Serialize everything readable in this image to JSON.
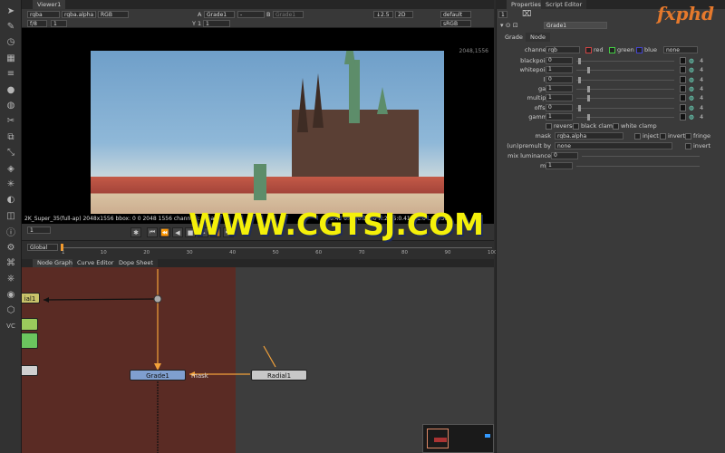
{
  "left_toolbar": {
    "icons": [
      "pointer-icon",
      "paint-icon",
      "clock-icon",
      "filter-icon",
      "channels-icon",
      "color-icon",
      "blur-icon",
      "keyer-icon",
      "merge-icon",
      "transform-icon",
      "3d-icon",
      "particles-icon",
      "deep-icon",
      "views-icon",
      "metadata-icon",
      "toolsets-icon",
      "other-icon",
      "furnace-icon",
      "ocula-icon",
      "cara-icon",
      "vc-icon"
    ],
    "vc_label": "VC"
  },
  "viewer": {
    "tab_label": "Viewer1",
    "channels": "rgba",
    "alpha": "rgba.alpha",
    "display": "RGB",
    "input_a_label": "A",
    "input_a": "Grade1",
    "input_a_op": "-",
    "input_b_label": "B",
    "input_b": "Grade1",
    "zoom": "f/8",
    "frame_field": "1",
    "gain": "Y 1",
    "exposure": "1",
    "proxy": "↓2.5",
    "view_mode": "2D",
    "lut": "default",
    "colorspace": "sRGB",
    "format_size": "2048,1556",
    "info": "2K_Super_35(full-ap) 2048x1556 bbox: 0 0 2048 1556 channels: rgba",
    "info_right": "0.45  0.00   0.0000  H:24 S:0.41 V:1.0  L:0.5500",
    "current_frame": "1",
    "fps_label": "Global"
  },
  "timeline": {
    "ticks": [
      "1",
      "10",
      "20",
      "30",
      "40",
      "50",
      "60",
      "70",
      "80",
      "90",
      "100"
    ],
    "end_frame": "100"
  },
  "node_graph": {
    "tabs": [
      "Node Graph",
      "Curve Editor",
      "Dope Sheet"
    ],
    "nodes": {
      "radial_top": "ial1",
      "grade": "Grade1",
      "radial": "Radial1",
      "mask_label": "mask"
    }
  },
  "properties": {
    "tabs": [
      "Properties",
      "Script Editor"
    ],
    "count": "1",
    "node_name": "Grade1",
    "sub_tabs": [
      "Grade",
      "Node"
    ],
    "channels_label": "channels",
    "channels_value": "rgb",
    "channels_checks": [
      "red",
      "green",
      "blue"
    ],
    "channels_extra": "none",
    "rows": [
      {
        "label": "blackpoint",
        "value": "0"
      },
      {
        "label": "whitepoint",
        "value": "1"
      },
      {
        "label": "lift",
        "value": "0"
      },
      {
        "label": "gain",
        "value": "1"
      },
      {
        "label": "multiply",
        "value": "1"
      },
      {
        "label": "offset",
        "value": "0"
      },
      {
        "label": "gamma",
        "value": "1"
      }
    ],
    "clamp_checks": [
      "reverse",
      "black clamp",
      "white clamp"
    ],
    "mask_label": "mask",
    "mask_value": "rgba.alpha",
    "mask_checks": [
      "inject",
      "invert",
      "fringe"
    ],
    "unpremult_label": "(un)premult by",
    "unpremult_value": "none",
    "unpremult_invert": "invert",
    "mix_lum_label": "mix luminance",
    "mix_lum_value": "0",
    "mix_label": "mix",
    "mix_value": "1",
    "channel_count": "4"
  },
  "watermark": {
    "site": "WWW.CGTSJ.COM",
    "brand": "fxphd"
  },
  "colors": {
    "panel": "#3a3a3a",
    "backdrop": "#5a2b24",
    "node_grade": "#7f9fcf",
    "node_radial": "#c8c8c8",
    "node_green": "#6bc55e",
    "link_orange": "#f2a13a",
    "watermark_yellow": "#f4f00a",
    "fxphd_orange": "#e6792c"
  }
}
